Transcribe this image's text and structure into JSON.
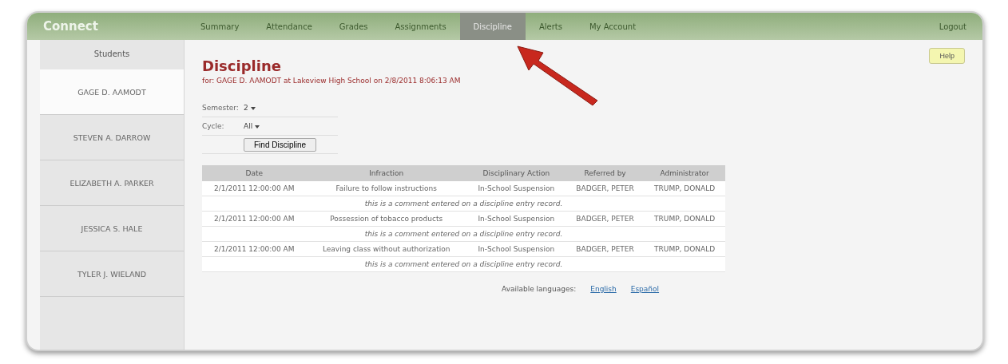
{
  "logo": "Connect",
  "nav": [
    {
      "label": "Summary",
      "selected": false
    },
    {
      "label": "Attendance",
      "selected": false
    },
    {
      "label": "Grades",
      "selected": false
    },
    {
      "label": "Assignments",
      "selected": false
    },
    {
      "label": "Discipline",
      "selected": true
    },
    {
      "label": "Alerts",
      "selected": false
    },
    {
      "label": "My Account",
      "selected": false
    }
  ],
  "logout": "Logout",
  "sidebar": {
    "title": "Students",
    "items": [
      {
        "label": "GAGE D. AAMODT",
        "selected": true
      },
      {
        "label": "STEVEN A. DARROW",
        "selected": false
      },
      {
        "label": "ELIZABETH A. PARKER",
        "selected": false
      },
      {
        "label": "JESSICA S. HALE",
        "selected": false
      },
      {
        "label": "TYLER J. WIELAND",
        "selected": false
      }
    ]
  },
  "heading": "Discipline",
  "subheading": "for: GAGE D. AAMODT at Lakeview High School on 2/8/2011 8:06:13 AM",
  "help": "Help",
  "filters": [
    {
      "label": "Semester:",
      "value": "2"
    },
    {
      "label": "Cycle:",
      "value": "All"
    }
  ],
  "find_button": "Find Discipline",
  "table": {
    "columns": [
      "Date",
      "Infraction",
      "Disciplinary Action",
      "Referred by",
      "Administrator"
    ],
    "rows": [
      {
        "cells": [
          "2/1/2011 12:00:00 AM",
          "Failure to follow instructions",
          "In-School Suspension",
          "BADGER, PETER",
          "TRUMP, DONALD"
        ],
        "comment": "this is a comment entered on a discipline entry record."
      },
      {
        "cells": [
          "2/1/2011 12:00:00 AM",
          "Possession of tobacco products",
          "In-School Suspension",
          "BADGER, PETER",
          "TRUMP, DONALD"
        ],
        "comment": "this is a comment entered on a discipline entry record."
      },
      {
        "cells": [
          "2/1/2011 12:00:00 AM",
          "Leaving class without authorization",
          "In-School Suspension",
          "BADGER, PETER",
          "TRUMP, DONALD"
        ],
        "comment": "this is a comment entered on a discipline entry record."
      }
    ]
  },
  "languages": {
    "label": "Available languages:",
    "links": [
      "English",
      "Español"
    ]
  }
}
